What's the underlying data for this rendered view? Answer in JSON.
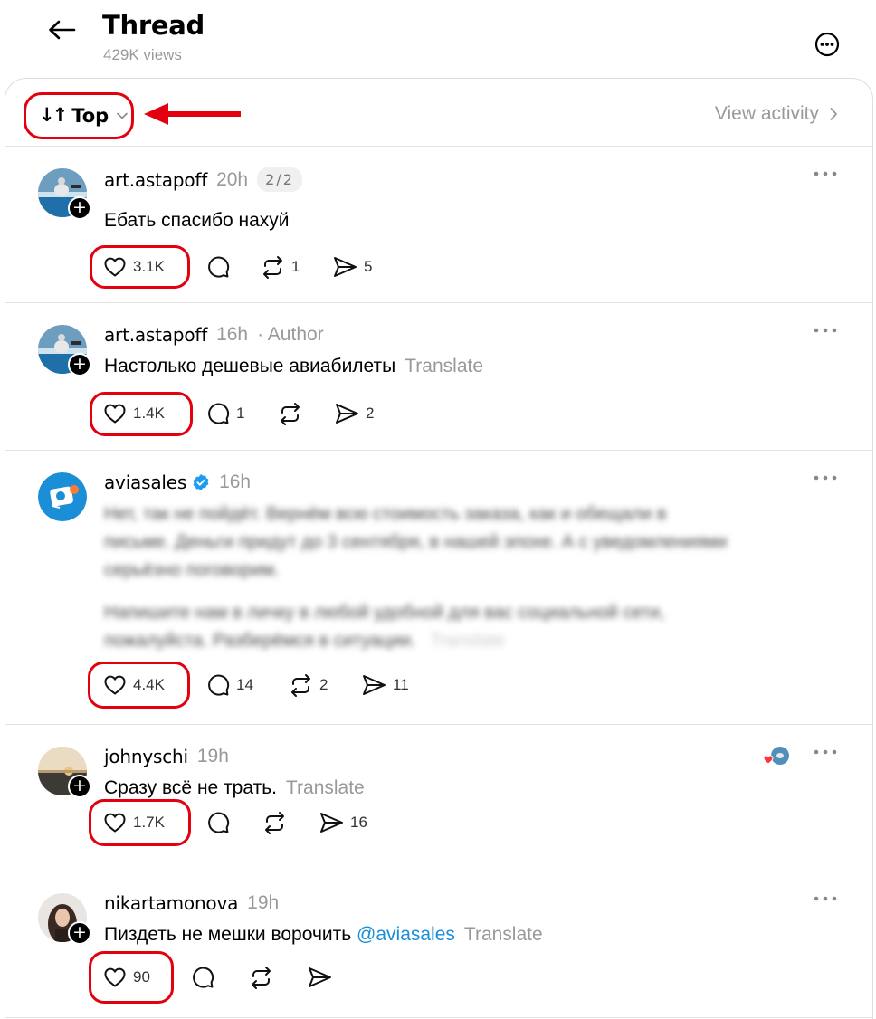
{
  "header": {
    "title": "Thread",
    "views": "429K views"
  },
  "sortbar": {
    "sort_label": "Top",
    "sort_icon": "↓↑",
    "view_activity": "View activity"
  },
  "posts": [
    {
      "username": "art.astapoff",
      "time": "20h",
      "badge": "2/2",
      "text": "Ебать спасибо нахуй",
      "likes": "3.1K",
      "replies": "",
      "reposts": "1",
      "shares": "5"
    },
    {
      "username": "art.astapoff",
      "time": "16h",
      "author_tag": "· Author",
      "text": "Настолько дешевые авиабилеты",
      "translate": "Translate",
      "likes": "1.4K",
      "replies": "1",
      "reposts": "",
      "shares": "2"
    },
    {
      "username": "aviasales",
      "time": "16h",
      "verified": true,
      "blurred_lines": [
        "Нет, так не пойдёт. Вернём всю стоимость заказа, как и обещали в",
        "письме. Деньги придут до 3 сентября, в нашей эпохе. А с уведомлениями",
        "серьёзно поговорим.",
        "Напишите нам в личку в любой удобной для вас социальной сети,",
        "пожалуйста. Разберёмся в ситуации.",
        "Translate"
      ],
      "likes": "4.4K",
      "replies": "14",
      "reposts": "2",
      "shares": "11"
    },
    {
      "username": "johnyschi",
      "time": "19h",
      "text": "Сразу всё не трать.",
      "translate": "Translate",
      "likes": "1.7K",
      "replies": "",
      "reposts": "",
      "shares": "16"
    },
    {
      "username": "nikartamonova",
      "time": "19h",
      "text": "Пиздеть не мешки ворочить",
      "mention": "@aviasales",
      "translate": "Translate",
      "likes": "90",
      "replies": "",
      "reposts": "",
      "shares": ""
    }
  ],
  "colors": {
    "annotation_red": "#e3000f",
    "verified_blue": "#1d9bf0",
    "mention_blue": "#1a8fd8",
    "muted_gray": "#999999"
  },
  "icons": [
    "back-arrow-icon",
    "more-circle-icon",
    "sort-arrows-icon",
    "chevron-down-icon",
    "chevron-right-icon",
    "heart-icon",
    "comment-icon",
    "repost-icon",
    "share-icon",
    "more-dots-icon",
    "verified-icon",
    "plus-icon"
  ]
}
